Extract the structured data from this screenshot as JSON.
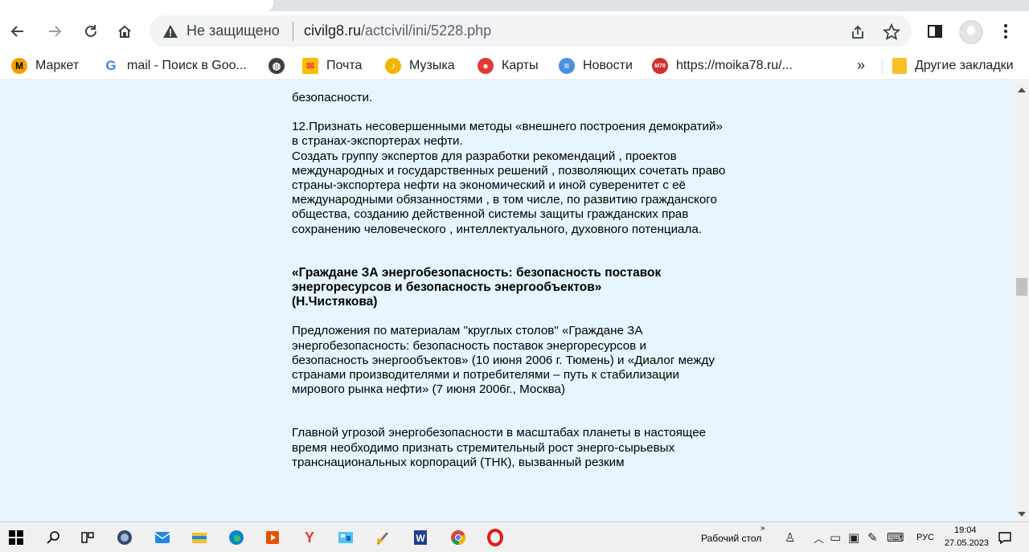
{
  "browser": {
    "security_label": "Не защищено",
    "url_domain": "civilg8.ru",
    "url_path": "/actcivil/ini/5228.php"
  },
  "bookmarks": {
    "items": [
      {
        "label": "Маркет",
        "icon": "yandex-market-icon",
        "color": "#f4a100"
      },
      {
        "label": "mail - Поиск в Goo...",
        "icon": "google-icon",
        "color": "#4285f4"
      },
      {
        "label": "",
        "icon": "globe-icon",
        "color": "#3c4043"
      },
      {
        "label": "Почта",
        "icon": "mail-icon",
        "color": "#fbbc04"
      },
      {
        "label": "Музыка",
        "icon": "music-icon",
        "color": "#f4b400"
      },
      {
        "label": "Карты",
        "icon": "maps-pin-icon",
        "color": "#e53935"
      },
      {
        "label": "Новости",
        "icon": "news-icon",
        "color": "#4a90e2"
      },
      {
        "label": "https://moika78.ru/...",
        "icon": "m78-icon",
        "color": "#d32f2f",
        "badge": "M78"
      }
    ],
    "more": "»",
    "other_label": "Другие закладки"
  },
  "article": {
    "top_fragment": "безопасности.",
    "item12_title": "12.Признать несовершенными методы «внешнего построения демократий» в странах-экспортерах нефти.",
    "item12_body": "Создать группу экспертов для разработки рекомендаций , проектов международных и государственных решений , позволяющих сочетать право страны-экспортера нефти на экономический и иной суверенитет с её международными обязанностями , в том числе, по развитию гражданского общества, созданию действенной системы защиты гражданских прав сохранению человеческого , интеллектуального, духовного потенциала.",
    "heading_line1": "«Граждане ЗА энергобезопасность: безопасность поставок",
    "heading_line2": "энергоресурсов и безопасность энергообъектов»",
    "heading_author": "(Н.Чистякова)",
    "proposal": "Предложения по материалам \"круглых столов\" «Граждане ЗА энергобезопасность: безопасность поставок энергоресурсов и безопасность энергообъектов» (10 июня 2006 г. Тюмень) и «Диалог между странами производителями и потребителями – путь к стабилизации мирового рынка нефти» (7 июня 2006г., Москва)",
    "threat": "Главной угрозой энергобезопасности в масштабах планеты в настоящее время необходимо признать стремительный рост энерго-сырьевых транснациональных корпораций (ТНК), вызванный резким"
  },
  "taskbar": {
    "desktop_label": "Рабочий стол",
    "lang": "РУС",
    "time": "19:04",
    "date": "27.05.2023"
  },
  "colors": {
    "page_bg": "#e6f5ff",
    "taskbar_bg": "#f0f0f0"
  }
}
